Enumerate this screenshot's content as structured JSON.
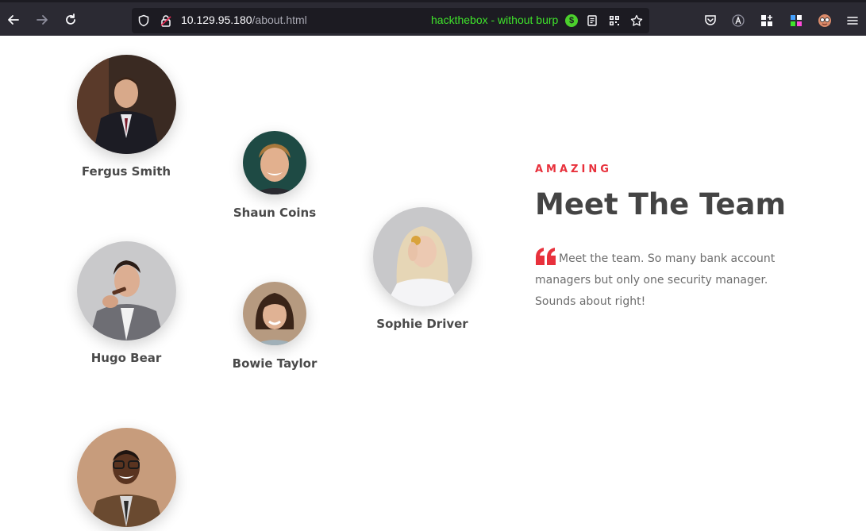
{
  "browser": {
    "url_host": "10.129.95.180",
    "url_path": "/about.html",
    "container_label": "hackthebox - without burp",
    "container_badge": "$",
    "icons": [
      "back-icon",
      "forward-icon",
      "reload-icon",
      "shield-icon",
      "lock-icon",
      "reader-icon",
      "qr-icon",
      "star-icon",
      "pocket-icon",
      "extension-icon",
      "extensions-grid-icon",
      "multi-container-icon",
      "profile-icon",
      "menu-icon"
    ]
  },
  "team": {
    "subtitle": "AMAZING",
    "title": "Meet The Team",
    "quote": "Meet the team. So many bank account managers but only one security manager. Sounds about right!",
    "members": [
      {
        "name": "Fergus Smith"
      },
      {
        "name": "Shaun Coins"
      },
      {
        "name": "Hugo Bear"
      },
      {
        "name": "Bowie Taylor"
      },
      {
        "name": "Sophie Driver"
      },
      {
        "name": ""
      }
    ]
  },
  "colors": {
    "accent": "#e8313c",
    "heading": "#444444",
    "chrome": "#2b2a33",
    "container": "#3fe32b"
  }
}
